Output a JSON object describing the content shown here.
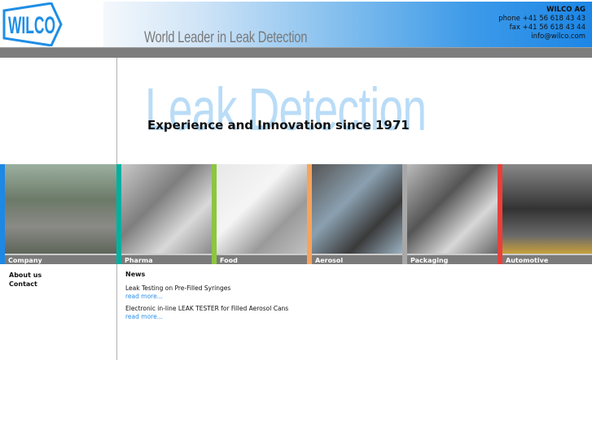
{
  "header": {
    "logo_text": "WILCO",
    "tagline": "World Leader in Leak Detection",
    "contact": {
      "company": "WILCO AG",
      "phone": "phone +41 56 618 43 43",
      "fax": "fax +41 56 618 43 44",
      "email": "info@wilco.com"
    }
  },
  "hero": {
    "background_text": "Leak Detection",
    "headline": "Experience and Innovation since 1971"
  },
  "tiles": [
    {
      "label": "Company",
      "color": "#1e88e5"
    },
    {
      "label": "Pharma",
      "color": "#00b0a0"
    },
    {
      "label": "Food",
      "color": "#8cc63f"
    },
    {
      "label": "Aerosol",
      "color": "#f7a35c"
    },
    {
      "label": "Packaging",
      "color": "#a8a8a8"
    },
    {
      "label": "Automotive",
      "color": "#e8403a"
    }
  ],
  "sidebar": {
    "items": [
      "About us",
      "Contact"
    ]
  },
  "news": {
    "heading": "News",
    "items": [
      {
        "title": "Leak Testing on Pre-Filled Syringes",
        "link": "read more..."
      },
      {
        "title": "Electronic in-line LEAK TESTER for Filled Aerosol Cans",
        "link": "read more..."
      }
    ]
  }
}
